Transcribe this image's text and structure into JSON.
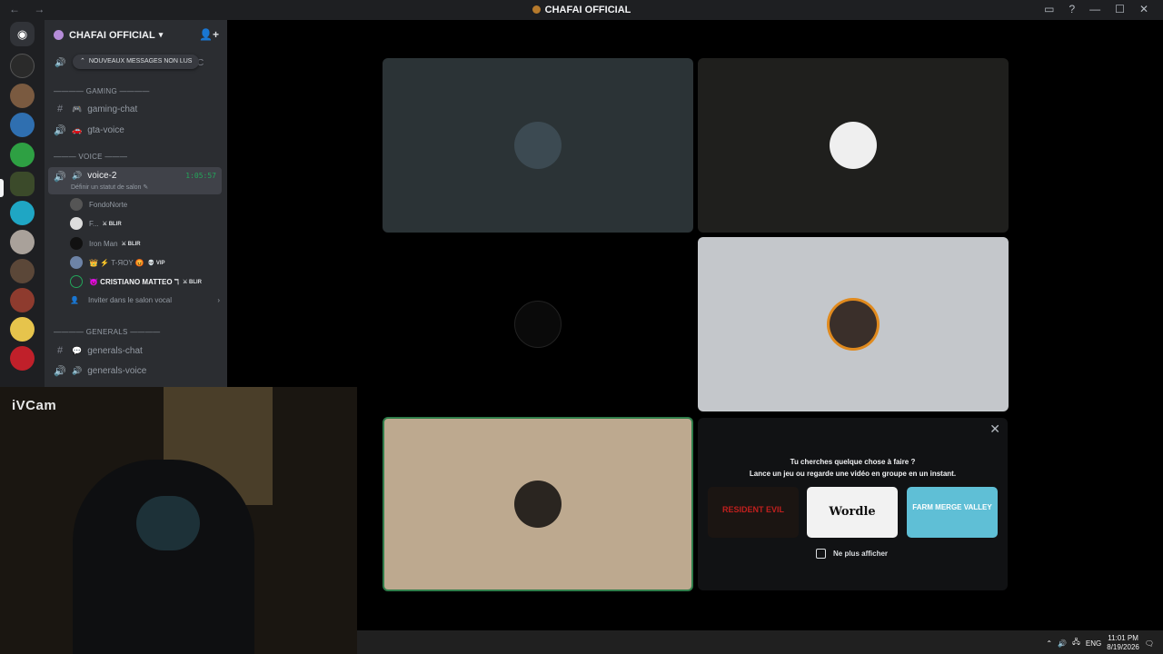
{
  "window": {
    "title": "CHAFAI OFFICIAL",
    "nav_arrows": "← →",
    "controls": [
      "▭",
      "?",
      "—",
      "☐",
      "✕"
    ]
  },
  "server": {
    "name": "CHAFAI OFFICIAL",
    "unread_banner": "NOUVEAUX MESSAGES NON LUS",
    "partial_channel_end": "C"
  },
  "categories": {
    "gaming": "———— GAMING ————",
    "voice": "——— VOICE ———",
    "generals": "———— GENERALS ————"
  },
  "channels": {
    "gaming_chat": "gaming-chat",
    "gta_voice": "gta-voice",
    "voice_2": "voice-2",
    "voice_2_timer": "1:05:57",
    "voice_2_status": "Définir un statut de salon ✎",
    "generals_chat": "generals-chat",
    "generals_voice": "generals-voice"
  },
  "members": [
    {
      "name": "FondoNorte",
      "tag": ""
    },
    {
      "name": "F...",
      "tag": "⚔ BLIR"
    },
    {
      "name": "Iron Man",
      "tag": "⚔ BLIR"
    },
    {
      "name": "👑 ⚡ T-ЯOY 😡",
      "tag": "💀 VIP"
    },
    {
      "name": "😈 CRISTIANO MATTEO ℸ",
      "tag": "⚔ BLIR"
    }
  ],
  "invite_label": "Inviter dans le salon vocal",
  "activity": {
    "line1": "Tu cherches quelque chose à faire ?",
    "line2": "Lance un jeu ou regarde une vidéo en groupe en un instant.",
    "games": [
      "RESIDENT EVIL",
      "Wordle",
      "FARM MERGE VALLEY"
    ],
    "dont_show": "Ne plus afficher",
    "close": "✕"
  },
  "camera": {
    "label": "iVCam"
  },
  "taskbar": {
    "lang": "ENG",
    "time": "11:01 PM",
    "date": "8/19/2026"
  }
}
